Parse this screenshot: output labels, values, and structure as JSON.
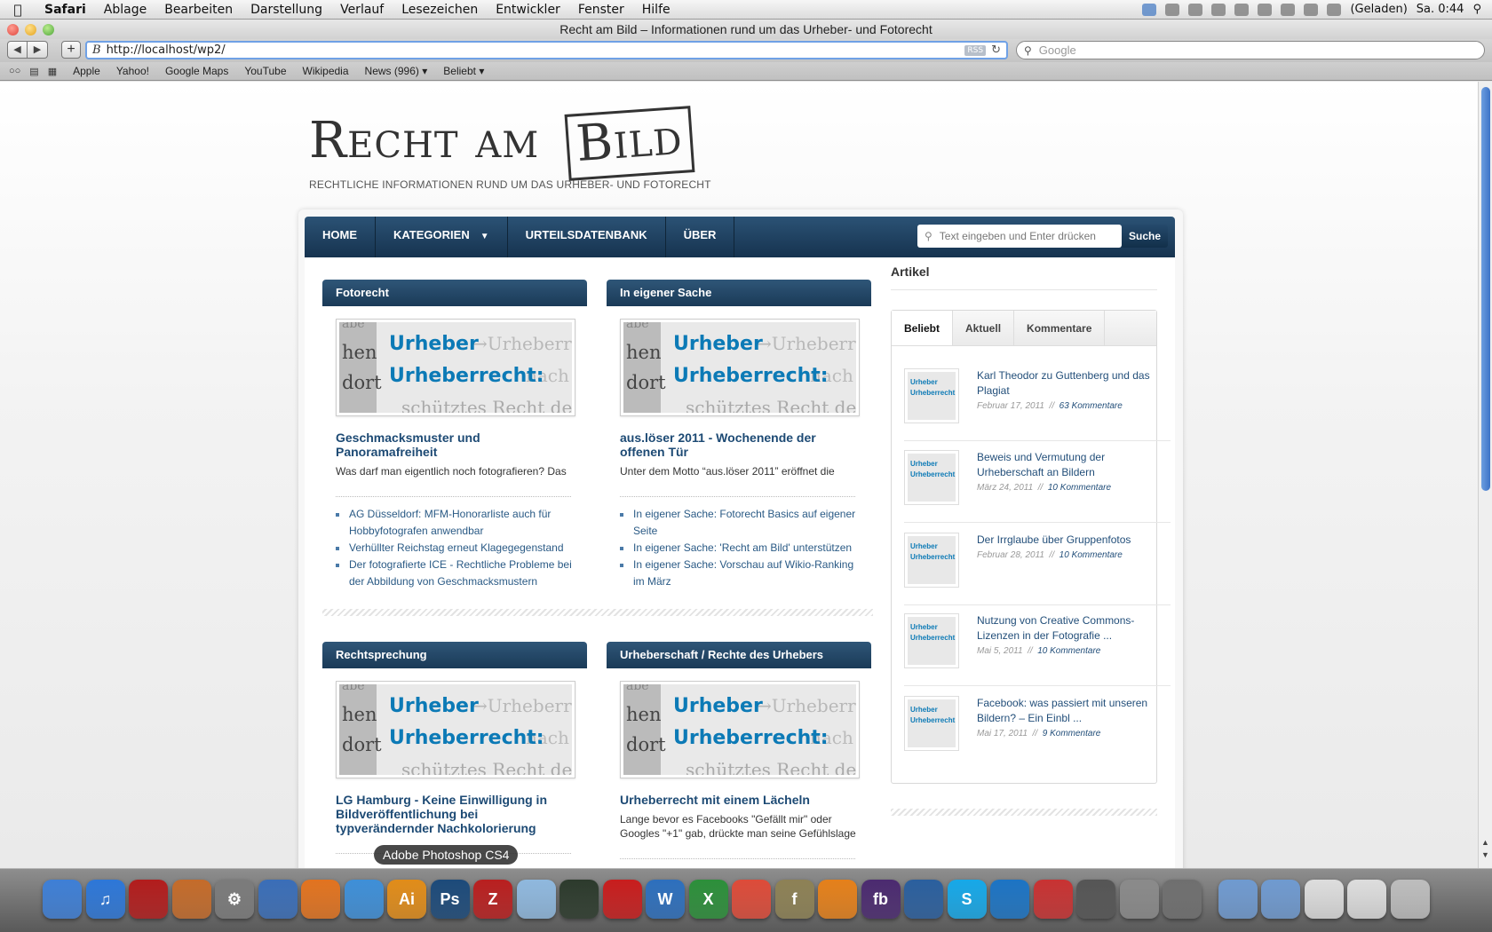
{
  "menubar": {
    "app": "Safari",
    "items": [
      "Ablage",
      "Bearbeiten",
      "Darstellung",
      "Verlauf",
      "Lesezeichen",
      "Entwickler",
      "Fenster",
      "Hilfe"
    ],
    "battery": "(Geladen)",
    "clock": "Sa. 0:44"
  },
  "window": {
    "title": "Recht am Bild – Informationen rund um das Urheber- und Fotorecht"
  },
  "toolbar": {
    "favicon": "B",
    "url": "http://localhost/wp2/",
    "rss": "RSS",
    "search_placeholder": "Google"
  },
  "bookmarks": [
    "Apple",
    "Yahoo!",
    "Google Maps",
    "YouTube",
    "Wikipedia",
    "News (996)",
    "Beliebt"
  ],
  "site": {
    "logo_recht": "R",
    "logo_echt": "ECHT",
    "logo_am": "AM",
    "logo_bild_b": "B",
    "logo_bild_rest": "ILD",
    "tagline": "RECHTLICHE INFORMATIONEN RUND UM DAS URHEBER- UND FOTORECHT",
    "nav": [
      "HOME",
      "KATEGORIEN",
      "URTEILSDATENBANK",
      "ÜBER"
    ],
    "search_placeholder": "Text eingeben und Enter drücken",
    "search_button": "Suche"
  },
  "image_words": {
    "w1": "Urheber",
    "w2": "Urheberrecht:",
    "g1": "→Urheberrecht",
    "g2": "nach d",
    "g3": "hen",
    "g4": "dort",
    "g5": "abe",
    "g6": "schütztes Recht des U"
  },
  "posts": [
    {
      "category": "Fotorecht",
      "title": "Geschmacksmuster und Panoramafreiheit",
      "excerpt": "Was darf man eigentlich noch fotografieren? Das",
      "links": [
        "AG Düsseldorf: MFM-Honorarliste auch für Hobbyfotografen anwendbar",
        "Verhüllter Reichstag erneut Klagegegenstand",
        "Der fotografierte ICE - Rechtliche Probleme bei der Abbildung von Geschmacksmustern"
      ]
    },
    {
      "category": "In eigener Sache",
      "title": "aus.löser 2011 - Wochenende der offenen Tür",
      "excerpt": "Unter dem Motto “aus.löser 2011” eröffnet die",
      "links": [
        "In eigener Sache: Fotorecht Basics auf eigener Seite",
        "In eigener Sache: 'Recht am Bild' unterstützen",
        "In eigener Sache: Vorschau auf Wikio-Ranking im März"
      ]
    },
    {
      "category": "Rechtsprechung",
      "title": "LG Hamburg - Keine Einwilligung in Bildveröffentlichung bei typverändernder Nachkolorierung",
      "excerpt": ""
    },
    {
      "category": "Urheberschaft / Rechte des Urhebers",
      "title": "Urheberrecht mit einem Lächeln",
      "excerpt": "Lange bevor es Facebooks \"Gefällt mir\" oder Googles \"+1\" gab, drückte man seine Gefühlslage"
    }
  ],
  "sidebar": {
    "heading": "Artikel",
    "tabs": [
      "Beliebt",
      "Aktuell",
      "Kommentare"
    ],
    "thumb_text": "Urheber Urheberrecht",
    "popular": [
      {
        "title": "Karl Theodor zu Guttenberg und das Plagiat",
        "date": "Februar 17, 2011",
        "sep": "//",
        "comments": "63 Kommentare"
      },
      {
        "title": "Beweis und Vermutung der Urheberschaft an Bildern",
        "date": "März 24, 2011",
        "sep": "//",
        "comments": "10 Kommentare"
      },
      {
        "title": "Der Irrglaube über Gruppenfotos",
        "date": "Februar 28, 2011",
        "sep": "//",
        "comments": "10 Kommentare"
      },
      {
        "title": "Nutzung von Creative Commons-Lizenzen in der Fotografie ...",
        "date": "Mai 5, 2011",
        "sep": "//",
        "comments": "10 Kommentare"
      },
      {
        "title": "Facebook: was passiert mit unseren Bildern? – Ein Einbl ...",
        "date": "Mai 17, 2011",
        "sep": "//",
        "comments": "9 Kommentare"
      }
    ]
  },
  "dock": {
    "tooltip": "Adobe Photoshop CS4",
    "icons": [
      {
        "name": "finder-icon",
        "label": "",
        "color": "#3e7fd6"
      },
      {
        "name": "itunes-icon",
        "label": "♫",
        "color": "#2d77d8"
      },
      {
        "name": "photo-booth-icon",
        "label": "",
        "color": "#b21c1c"
      },
      {
        "name": "iphoto-icon",
        "label": "",
        "color": "#c46b2a"
      },
      {
        "name": "system-preferences-icon",
        "label": "⚙",
        "color": "#7b7b7b"
      },
      {
        "name": "thunderbird-icon",
        "label": "",
        "color": "#3a6eb8"
      },
      {
        "name": "firefox-icon",
        "label": "",
        "color": "#e2731f"
      },
      {
        "name": "safari-icon",
        "label": "",
        "color": "#3e8fd8"
      },
      {
        "name": "illustrator-icon",
        "label": "Ai",
        "color": "#e18c19"
      },
      {
        "name": "photoshop-icon",
        "label": "Ps",
        "color": "#1c4a7a"
      },
      {
        "name": "filezilla-icon",
        "label": "Z",
        "color": "#b91f1f"
      },
      {
        "name": "cube-app-icon",
        "label": "",
        "color": "#8fb8de"
      },
      {
        "name": "activity-monitor-icon",
        "label": "",
        "color": "#2c3a2c"
      },
      {
        "name": "acrobat-icon",
        "label": "",
        "color": "#c81d1d"
      },
      {
        "name": "word-icon",
        "label": "W",
        "color": "#2d6fbd"
      },
      {
        "name": "excel-icon",
        "label": "X",
        "color": "#2c8f3a"
      },
      {
        "name": "chrome-icon",
        "label": "",
        "color": "#dd4b39"
      },
      {
        "name": "fontexplorer-icon",
        "label": "f",
        "color": "#8d8155"
      },
      {
        "name": "vlc-icon",
        "label": "",
        "color": "#e5801a"
      },
      {
        "name": "flash-builder-icon",
        "label": "fb",
        "color": "#4b2a70"
      },
      {
        "name": "virtualbox-icon",
        "label": "",
        "color": "#2a5f9e"
      },
      {
        "name": "skype-icon",
        "label": "S",
        "color": "#16a8e8"
      },
      {
        "name": "teamviewer-icon",
        "label": "",
        "color": "#1c74c4"
      },
      {
        "name": "angry-birds-icon",
        "label": "",
        "color": "#c83232"
      },
      {
        "name": "disk-utility-icon",
        "label": "",
        "color": "#555555"
      },
      {
        "name": "window-manager-icon",
        "label": "",
        "color": "#8a8a8a"
      },
      {
        "name": "time-machine-icon",
        "label": "",
        "color": "#6f6f6f"
      },
      {
        "name": "applications-folder-icon",
        "label": "",
        "color": "#6f9ad0"
      },
      {
        "name": "documents-folder-icon",
        "label": "",
        "color": "#6f9ad0"
      },
      {
        "name": "pdf-document-icon",
        "label": "",
        "color": "#dddddd"
      },
      {
        "name": "word-document-icon",
        "label": "",
        "color": "#dddddd"
      },
      {
        "name": "trash-icon",
        "label": "",
        "color": "#bdbdbd"
      }
    ]
  }
}
